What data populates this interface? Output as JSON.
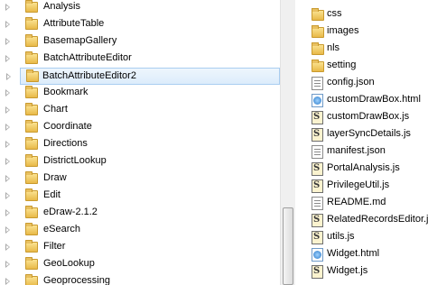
{
  "tree": {
    "items": [
      {
        "label": "Analysis"
      },
      {
        "label": "AttributeTable"
      },
      {
        "label": "BasemapGallery"
      },
      {
        "label": "BatchAttributeEditor"
      },
      {
        "label": "BatchAttributeEditor2",
        "selected": true
      },
      {
        "label": "Bookmark"
      },
      {
        "label": "Chart"
      },
      {
        "label": "Coordinate"
      },
      {
        "label": "Directions"
      },
      {
        "label": "DistrictLookup"
      },
      {
        "label": "Draw"
      },
      {
        "label": "Edit"
      },
      {
        "label": "eDraw-2.1.2"
      },
      {
        "label": "eSearch"
      },
      {
        "label": "Filter"
      },
      {
        "label": "GeoLookup"
      },
      {
        "label": "Geoprocessing"
      }
    ]
  },
  "files": {
    "items": [
      {
        "label": "css",
        "icon": "folder-icon"
      },
      {
        "label": "images",
        "icon": "folder-icon"
      },
      {
        "label": "nls",
        "icon": "folder-icon"
      },
      {
        "label": "setting",
        "icon": "folder-icon"
      },
      {
        "label": "config.json",
        "icon": "json-file-icon"
      },
      {
        "label": "customDrawBox.html",
        "icon": "html-file-icon"
      },
      {
        "label": "customDrawBox.js",
        "icon": "script-file-icon"
      },
      {
        "label": "layerSyncDetails.js",
        "icon": "script-file-icon"
      },
      {
        "label": "manifest.json",
        "icon": "json-file-icon"
      },
      {
        "label": "PortalAnalysis.js",
        "icon": "script-file-icon"
      },
      {
        "label": "PrivilegeUtil.js",
        "icon": "script-file-icon"
      },
      {
        "label": "README.md",
        "icon": "text-file-icon"
      },
      {
        "label": "RelatedRecordsEditor.js",
        "icon": "script-file-icon"
      },
      {
        "label": "utils.js",
        "icon": "script-file-icon"
      },
      {
        "label": "Widget.html",
        "icon": "html-file-icon"
      },
      {
        "label": "Widget.js",
        "icon": "script-file-icon"
      }
    ]
  },
  "colors": {
    "selection_bg": "#dcecfb",
    "selection_border": "#a9cdf0",
    "folder": "#e8b948"
  }
}
